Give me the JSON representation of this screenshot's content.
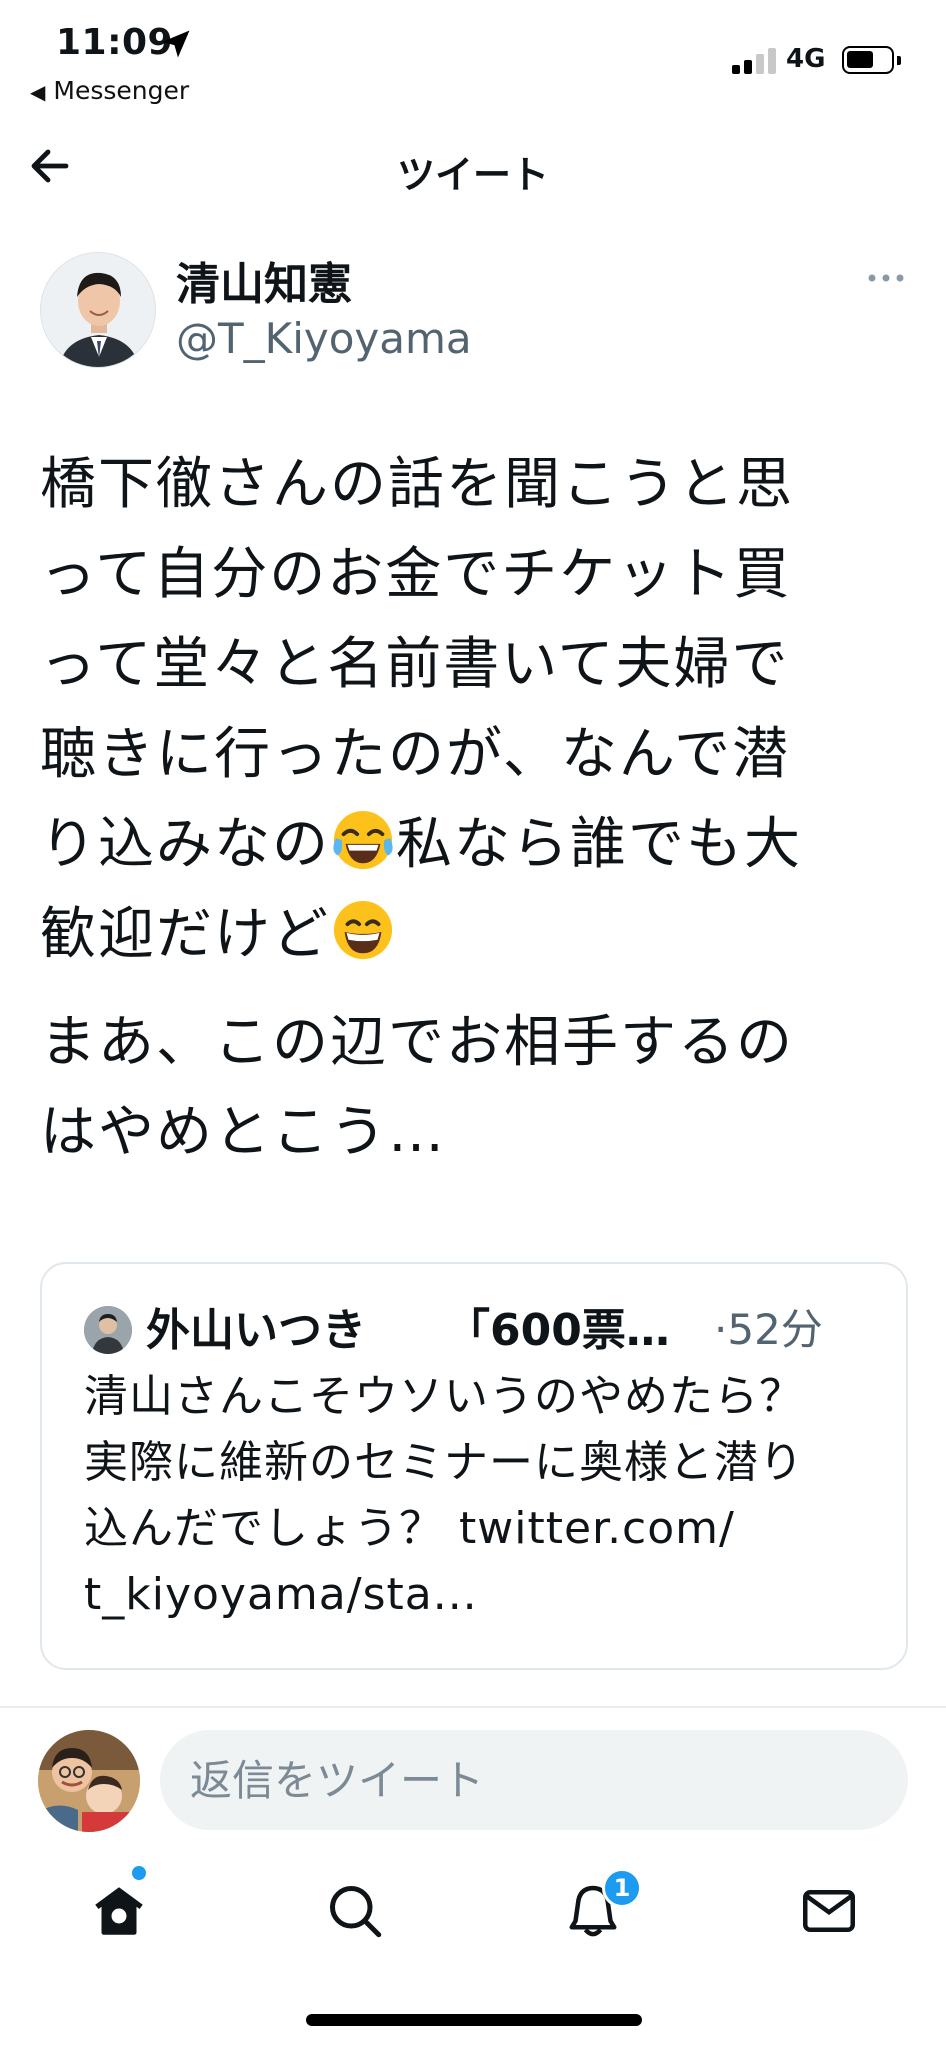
{
  "status_bar": {
    "time": "11:09",
    "back_app": "Messenger",
    "network": "4G",
    "signal_bars_active": 2,
    "battery_level": 0.6
  },
  "header": {
    "title": "ツイート"
  },
  "tweet": {
    "author_name": "清山知憲",
    "author_handle": "@T_Kiyoyama",
    "text_line1": "橋下徹さんの話を聞こうと思",
    "text_line2": "って自分のお金でチケット買",
    "text_line3": "って堂々と名前書いて夫婦で",
    "text_line4": "聴きに行ったのが、なんで潜",
    "text_line5a": "り込みなの",
    "emoji_1": "face-with-tears-of-joy-emoji",
    "text_line5b": "私なら誰でも大",
    "text_line6a": "歓迎だけど",
    "emoji_2": "grinning-face-emoji",
    "text_para2_line1": "まあ、この辺でお相手するの",
    "text_para2_line2": "はやめとこう…"
  },
  "quote": {
    "author_name": "外山いつき",
    "snippet": "「600票…",
    "time": "·52分",
    "text_line1": "清山さんこそウソいうのやめたら？",
    "text_line2": "実際に維新のセミナーに奥様と潜り",
    "text_line3": "込んだでしょう？ twitter.com/",
    "text_line4": "t_kiyoyama/sta..."
  },
  "reply": {
    "placeholder": "返信をツイート"
  },
  "nav": {
    "items": [
      "home-icon",
      "search-icon",
      "notifications-icon",
      "messages-icon"
    ],
    "notification_count": "1"
  },
  "colors": {
    "accent": "#1d9bf0",
    "secondary_text": "#536471",
    "border": "#e1e8ed"
  }
}
